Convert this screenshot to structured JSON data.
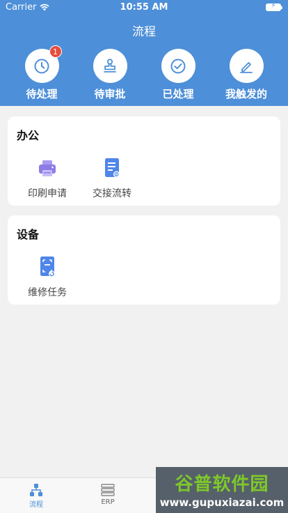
{
  "status_bar": {
    "carrier": "Carrier",
    "time": "10:55 AM"
  },
  "header": {
    "title": "流程"
  },
  "quick_actions": [
    {
      "label": "待处理",
      "icon": "clock-icon",
      "badge": "1"
    },
    {
      "label": "待审批",
      "icon": "stamp-icon"
    },
    {
      "label": "已处理",
      "icon": "check-circle-icon"
    },
    {
      "label": "我触发的",
      "icon": "pencil-icon"
    }
  ],
  "sections": [
    {
      "title": "办公",
      "apps": [
        {
          "label": "印刷申请",
          "icon": "printer-icon"
        },
        {
          "label": "交接流转",
          "icon": "document-transfer-icon"
        }
      ]
    },
    {
      "title": "设备",
      "apps": [
        {
          "label": "维修任务",
          "icon": "repair-document-icon"
        }
      ]
    }
  ],
  "tab_bar": {
    "tabs": [
      {
        "label": "流程",
        "icon": "flow-chart-icon",
        "active": true
      },
      {
        "label": "ERP",
        "icon": "list-icon",
        "active": false
      }
    ]
  },
  "watermark": {
    "line1": "谷普软件园",
    "line2": "www.gupuxiazai.com"
  },
  "colors": {
    "primary": "#4d8fd8",
    "badge": "#e74c3c",
    "app_purple": "#8e7ce6",
    "app_blue": "#4f86e8"
  }
}
